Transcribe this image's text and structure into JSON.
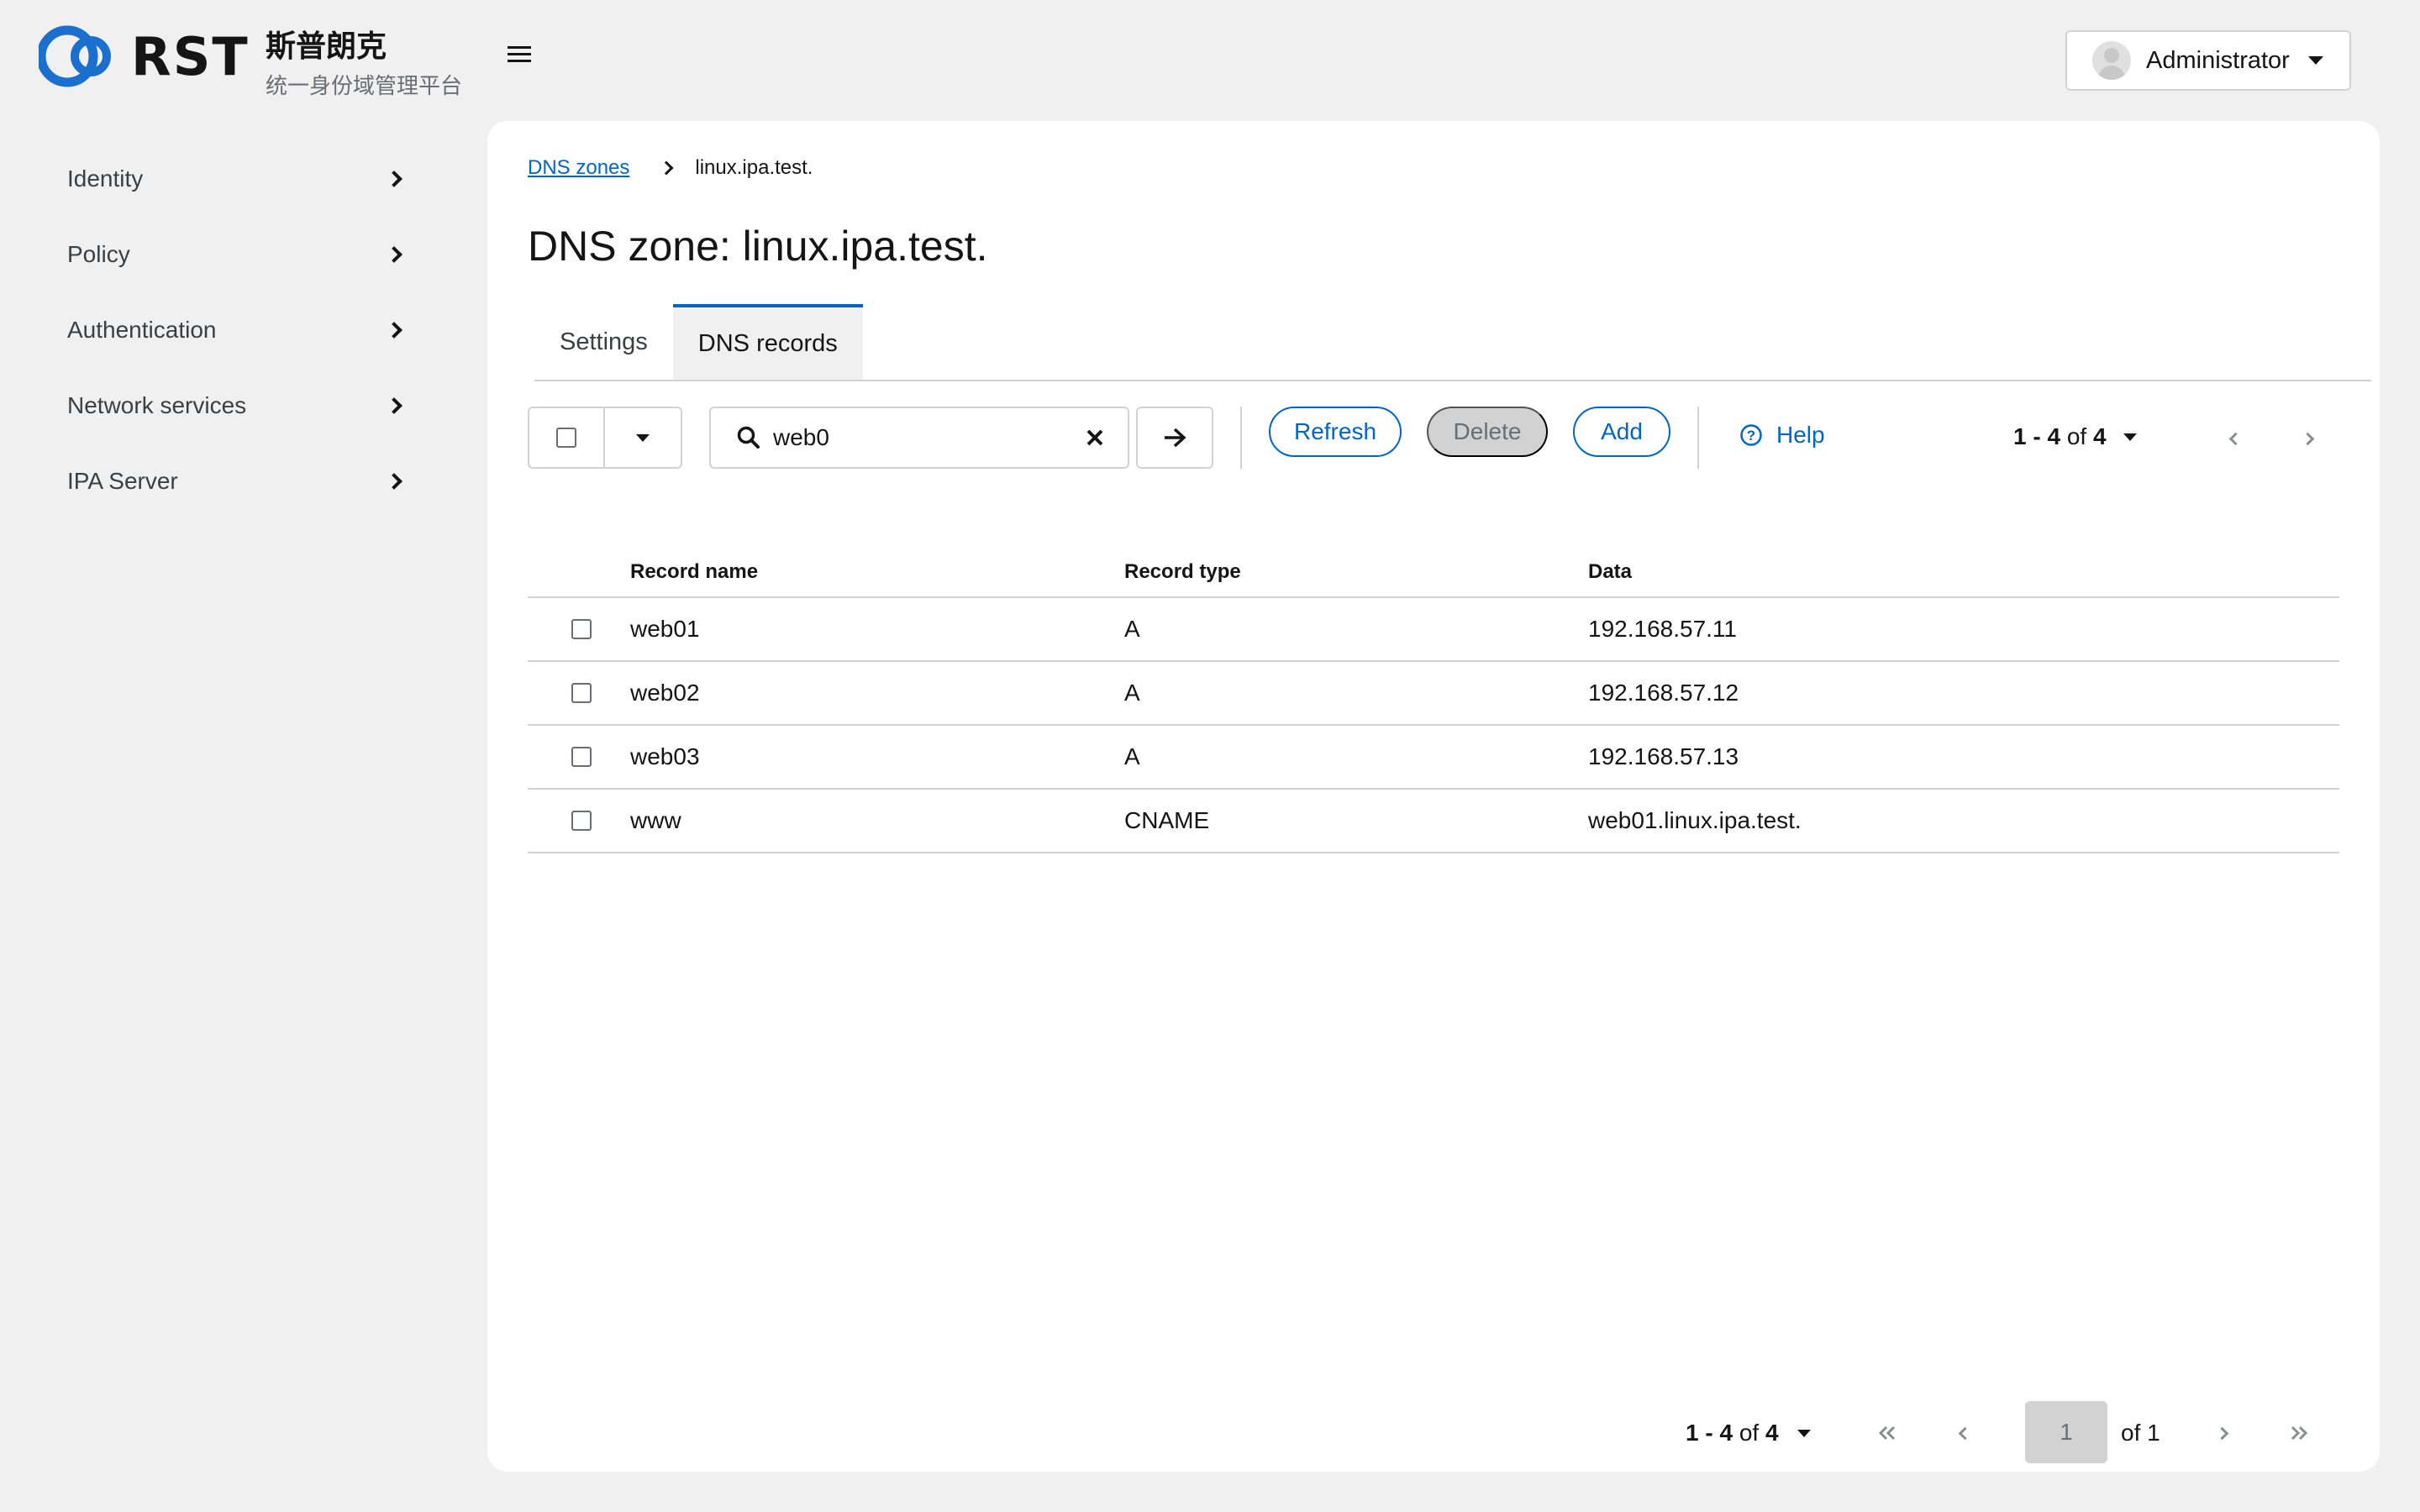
{
  "header": {
    "logo_text": "RST",
    "brand_name": "斯普朗克",
    "brand_subtitle": "统一身份域管理平台",
    "user": "Administrator"
  },
  "sidebar": {
    "items": [
      {
        "label": "Identity"
      },
      {
        "label": "Policy"
      },
      {
        "label": "Authentication"
      },
      {
        "label": "Network services"
      },
      {
        "label": "IPA Server"
      }
    ]
  },
  "breadcrumb": {
    "parent": "DNS zones",
    "current": "linux.ipa.test."
  },
  "page_title": "DNS zone: linux.ipa.test.",
  "tabs": [
    {
      "label": "Settings",
      "active": false
    },
    {
      "label": "DNS records",
      "active": true
    }
  ],
  "toolbar": {
    "search_value": "web0",
    "refresh_label": "Refresh",
    "delete_label": "Delete",
    "add_label": "Add",
    "help_label": "Help",
    "range": "1 - 4",
    "of_word": "of",
    "total": "4"
  },
  "table": {
    "columns": [
      "Record name",
      "Record type",
      "Data"
    ],
    "rows": [
      {
        "name": "web01",
        "type": "A",
        "data": "192.168.57.11"
      },
      {
        "name": "web02",
        "type": "A",
        "data": "192.168.57.12"
      },
      {
        "name": "web03",
        "type": "A",
        "data": "192.168.57.13"
      },
      {
        "name": "www",
        "type": "CNAME",
        "data": "web01.linux.ipa.test."
      }
    ]
  },
  "pagination": {
    "range": "1 - 4",
    "of_word": "of",
    "total": "4",
    "current_page": "1",
    "of_pages": "of 1"
  },
  "colors": {
    "accent": "#0066cc",
    "background": "#f0f0f0",
    "card": "#ffffff",
    "border": "#d2d2d2"
  }
}
